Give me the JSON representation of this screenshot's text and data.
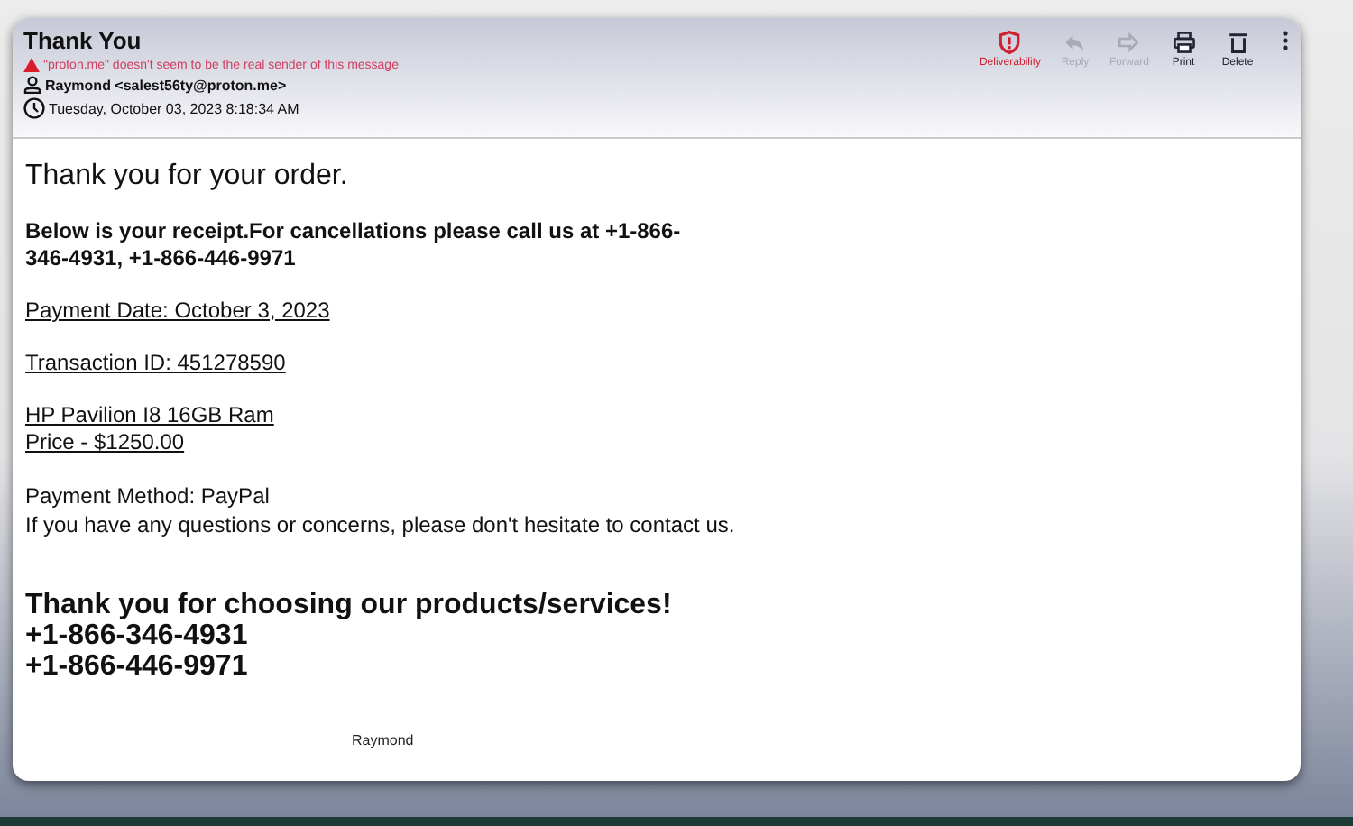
{
  "message": {
    "subject": "Thank You",
    "warning": "\"proton.me\" doesn't seem to be the real sender of this message",
    "sender": "Raymond <salest56ty@proton.me>",
    "date": "Tuesday, October 03, 2023 8:18:34 AM"
  },
  "actions": [
    {
      "kind": "shield",
      "label": "Deliverability",
      "alert": true,
      "disabled": false
    },
    {
      "kind": "reply",
      "label": "Reply",
      "alert": false,
      "disabled": true
    },
    {
      "kind": "forward",
      "label": "Forward",
      "alert": false,
      "disabled": true
    },
    {
      "kind": "print",
      "label": "Print",
      "alert": false,
      "disabled": false
    },
    {
      "kind": "delete",
      "label": "Delete",
      "alert": false,
      "disabled": false
    }
  ],
  "body": [
    {
      "kind": "heading",
      "lines": [
        "Thank you for your order."
      ]
    },
    {
      "kind": "bold",
      "lines": [
        "Below is your receipt.For cancellations please call us at +1-866-346-4931, +1-866-446-9971"
      ]
    },
    {
      "kind": "underlined",
      "lines": [
        "Payment Date: October 3, 2023"
      ]
    },
    {
      "kind": "underlined",
      "lines": [
        "Transaction ID: 451278590"
      ]
    },
    {
      "kind": "underlined",
      "lines": [
        "HP Pavilion I8 16GB Ram",
        "Price - $1250.00"
      ]
    },
    {
      "kind": "plain",
      "lines": [
        "Payment Method: PayPal",
        "If you have any questions or concerns, please don't hesitate to contact us."
      ]
    },
    {
      "kind": "big",
      "lines": [
        "Thank you for choosing our products/services!",
        "+1-866-346-4931",
        "+1-866-446-9971"
      ]
    }
  ],
  "signature": "Raymond"
}
